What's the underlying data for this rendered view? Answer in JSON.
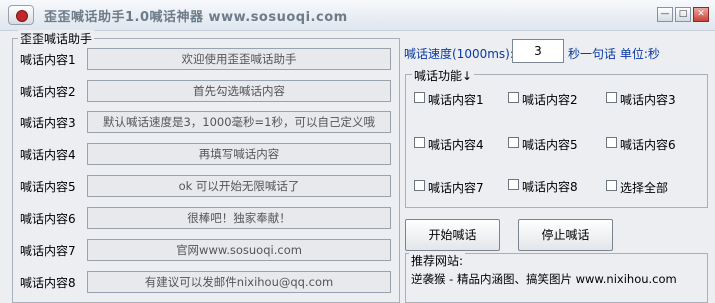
{
  "window": {
    "title": "歪歪喊话助手1.0喊话神器 www.sosuoqi.com",
    "minimize_glyph": "—",
    "maximize_glyph": "□",
    "close_glyph": "✕"
  },
  "left_panel": {
    "title": "歪歪喊话助手",
    "rows": [
      {
        "label": "喊话内容1",
        "value": "欢迎使用歪歪喊话助手"
      },
      {
        "label": "喊话内容2",
        "value": "首先勾选喊话内容"
      },
      {
        "label": "喊话内容3",
        "value": "默认喊话速度是3，1000毫秒=1秒，可以自己定义哦"
      },
      {
        "label": "喊话内容4",
        "value": "再填写喊话内容"
      },
      {
        "label": "喊话内容5",
        "value": "ok  可以开始无限喊话了"
      },
      {
        "label": "喊话内容6",
        "value": "很棒吧！独家奉献！"
      },
      {
        "label": "喊话内容7",
        "value": "官网www.sosuoqi.com"
      },
      {
        "label": "喊话内容8",
        "value": "有建议可以发邮件nixihou@qq.com"
      }
    ]
  },
  "speed": {
    "label": "喊话速度(1000ms):",
    "value": "3",
    "suffix": "秒一句话 单位:秒"
  },
  "functions": {
    "title": "喊话功能↓",
    "options": [
      {
        "label": "喊话内容1",
        "checked": false
      },
      {
        "label": "喊话内容2",
        "checked": false
      },
      {
        "label": "喊话内容3",
        "checked": false
      },
      {
        "label": "喊话内容4",
        "checked": false
      },
      {
        "label": "喊话内容5",
        "checked": false
      },
      {
        "label": "喊话内容6",
        "checked": false
      },
      {
        "label": "喊话内容7",
        "checked": false
      },
      {
        "label": "喊话内容8",
        "checked": false
      },
      {
        "label": "选择全部",
        "checked": false
      }
    ]
  },
  "buttons": {
    "start": "开始喊话",
    "stop": "停止喊话"
  },
  "recommend": {
    "title": "推荐网站:",
    "line": "逆袭猴 - 精品内涵图、搞笑图片 www.nixihou.com"
  }
}
